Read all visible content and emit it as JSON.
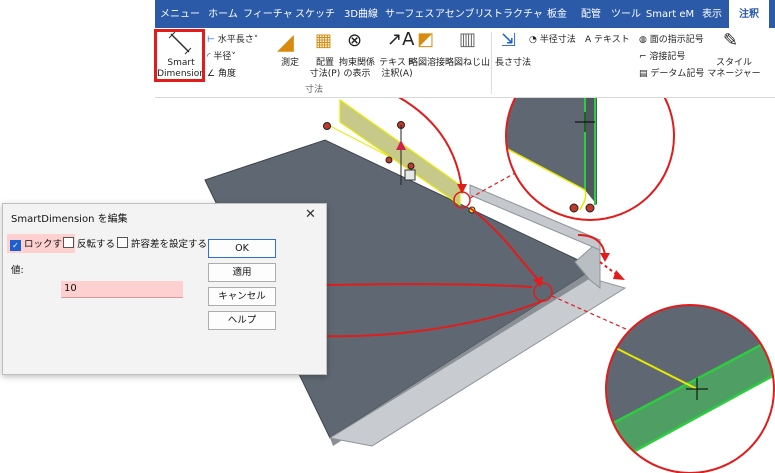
{
  "ribbon": {
    "tabs": [
      "メニュー",
      "ホーム",
      "フィーチャ",
      "スケッチ",
      "3D曲線",
      "サーフェス",
      "アセンブリ",
      "ストラクチャ",
      "板金",
      "配管",
      "ツール",
      "Smart eM",
      "表示",
      "注釈"
    ],
    "active_tab": "注釈",
    "smart_dimension": "Smart\nDimension",
    "horizontal_length": "水平長さ",
    "radius": "半径",
    "angle": "角度",
    "measure": "測定",
    "place_dimension": "配置",
    "place_dimension_line2": "寸法(P)",
    "show_constraints": "拘束関係",
    "show_constraints_line2": "の表示",
    "text_annotation": "テキスト",
    "text_annotation_line2": "注釈(A)",
    "weld_symbol": "略図溶接",
    "thread_symbol": "略図ねじ山",
    "group_dimension": "寸法",
    "length_dim": "長さ寸法",
    "radius_dim": "半径寸法",
    "text": "テキスト",
    "surface_symbol": "面の指示記号",
    "weld_mark": "溶接記号",
    "datum_mark": "データム記号",
    "style_manager": "スタイル",
    "style_manager_line2": "マネージャー"
  },
  "dialog": {
    "title": "SmartDimension を編集",
    "close": "✕",
    "lock": "ロックする",
    "reverse": "反転する",
    "tolerance": "許容差を設定する",
    "value_label": "値:",
    "value": "10",
    "ok": "OK",
    "apply": "適用",
    "cancel": "キャンセル",
    "help": "ヘルプ"
  },
  "colors": {
    "accent_red": "#e21b1b",
    "tab_blue": "#2b5aa8",
    "model_gray": "#5d6670",
    "highlight_green": "#2ecc40",
    "highlight_yellow": "#f2f200"
  }
}
